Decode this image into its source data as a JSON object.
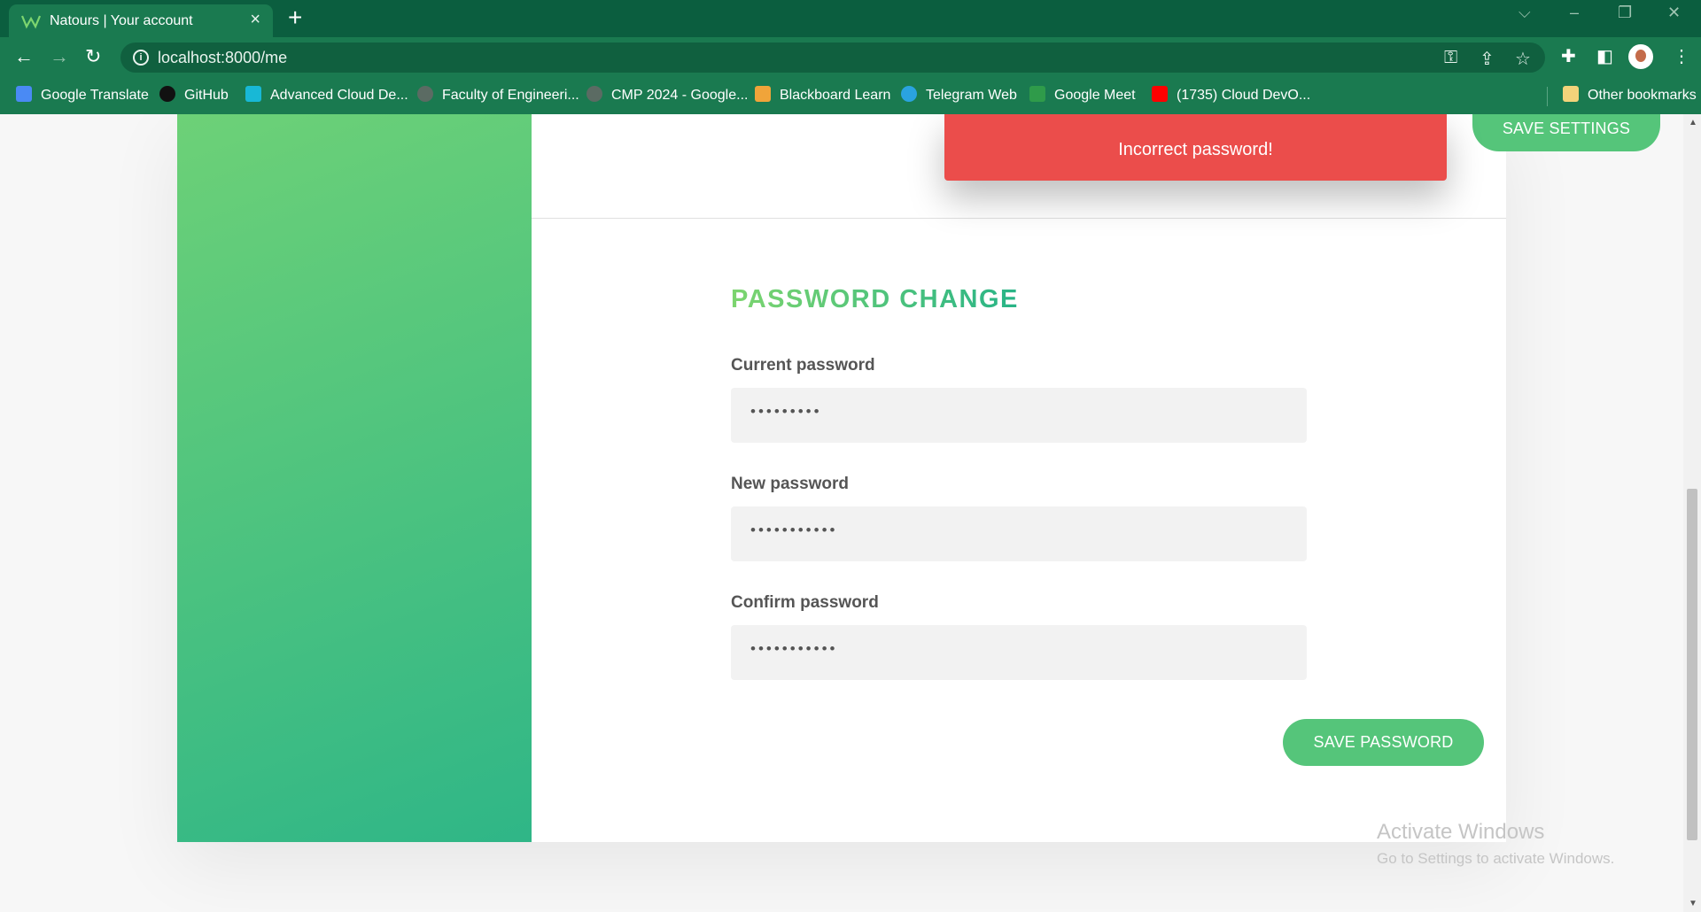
{
  "browser": {
    "tab_title": "Natours | Your account",
    "url": "localhost:8000/me",
    "bookmarks": [
      "Google Translate",
      "GitHub",
      "Advanced Cloud De...",
      "Faculty of Engineeri...",
      "CMP 2024 - Google...",
      "Blackboard Learn",
      "Telegram Web",
      "Google Meet",
      "(1735) Cloud DevO..."
    ],
    "other_bookmarks": "Other bookmarks"
  },
  "alert": {
    "message": "Incorrect password!",
    "color": "#eb4d4b"
  },
  "settings": {
    "save_label": "SAVE SETTINGS"
  },
  "password_change": {
    "title": "PASSWORD CHANGE",
    "current_label": "Current password",
    "current_value": "•••••••••",
    "new_label": "New password",
    "new_value": "•••••••••••",
    "confirm_label": "Confirm password",
    "confirm_value": "•••••••••••",
    "save_label": "SAVE PASSWORD"
  },
  "watermark": {
    "title": "Activate Windows",
    "subtitle": "Go to Settings to activate Windows."
  },
  "colors": {
    "accent": "#55c57a",
    "chrome": "#1a7a50"
  },
  "icons": [
    "natours-favicon",
    "close-icon",
    "plus-icon",
    "back-icon",
    "forward-icon",
    "reload-icon",
    "info-icon",
    "key-icon",
    "share-icon",
    "star-icon",
    "extensions-icon",
    "sidepanel-icon",
    "menu-icon"
  ]
}
